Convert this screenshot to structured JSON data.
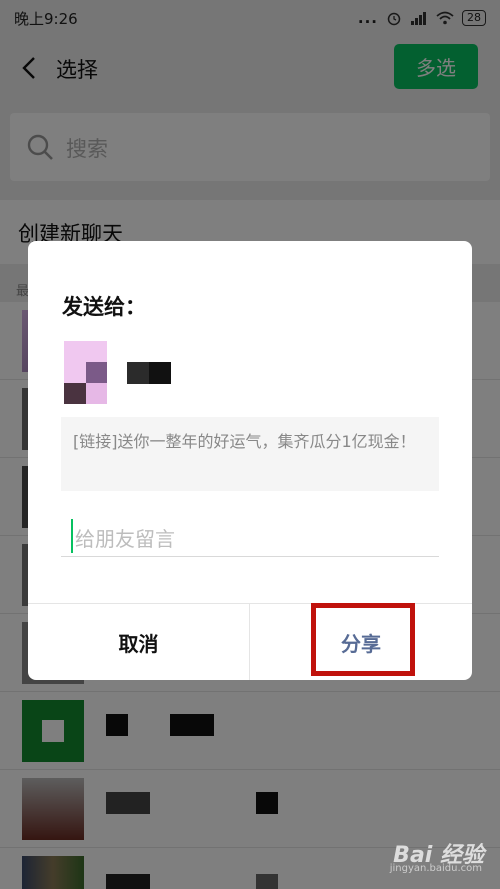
{
  "status_bar": {
    "time": "晚上9:26",
    "dots": "...",
    "battery": "28"
  },
  "nav": {
    "title": "选择",
    "multi_select": "多选"
  },
  "search": {
    "placeholder": "搜索"
  },
  "new_chat": "创建新聊天",
  "section_header": "最",
  "dialog": {
    "title": "发送给：",
    "link_text": "[链接]送你一整年的好运气，集齐瓜分1亿现金！",
    "message_placeholder": "给朋友留言",
    "cancel": "取消",
    "share": "分享"
  },
  "watermark": {
    "logo": "Bai 经验",
    "url": "jingyan.baidu.com"
  },
  "colors": {
    "accent_green": "#07c160",
    "link_blue": "#576b95",
    "highlight_red": "#c0120c"
  }
}
